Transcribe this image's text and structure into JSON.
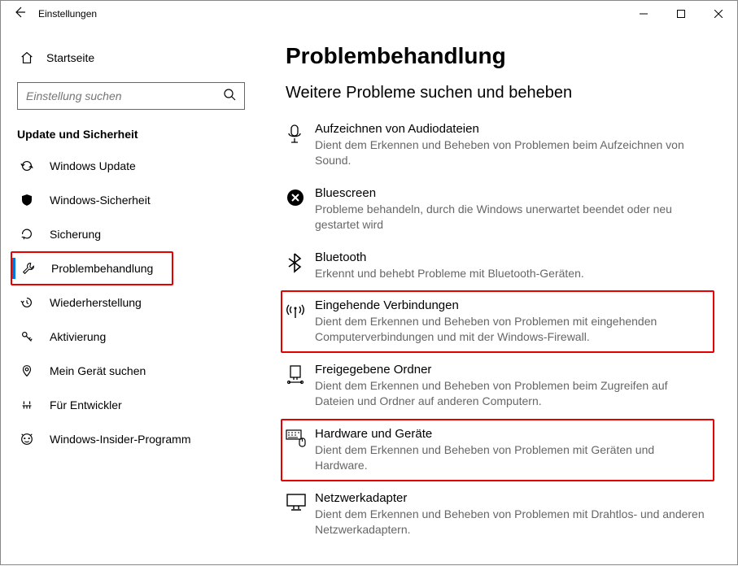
{
  "window": {
    "title": "Einstellungen"
  },
  "sidebar": {
    "home": "Startseite",
    "search_placeholder": "Einstellung suchen",
    "group": "Update und Sicherheit",
    "items": [
      {
        "label": "Windows Update"
      },
      {
        "label": "Windows-Sicherheit"
      },
      {
        "label": "Sicherung"
      },
      {
        "label": "Problembehandlung"
      },
      {
        "label": "Wiederherstellung"
      },
      {
        "label": "Aktivierung"
      },
      {
        "label": "Mein Gerät suchen"
      },
      {
        "label": "Für Entwickler"
      },
      {
        "label": "Windows-Insider-Programm"
      }
    ]
  },
  "main": {
    "heading": "Problembehandlung",
    "subheading": "Weitere Probleme suchen und beheben",
    "items": [
      {
        "label": "Aufzeichnen von Audiodateien",
        "desc": "Dient dem Erkennen und Beheben von Problemen beim Aufzeichnen von Sound."
      },
      {
        "label": "Bluescreen",
        "desc": "Probleme behandeln, durch die Windows unerwartet beendet oder neu gestartet wird"
      },
      {
        "label": "Bluetooth",
        "desc": "Erkennt und behebt Probleme mit Bluetooth-Geräten."
      },
      {
        "label": "Eingehende Verbindungen",
        "desc": "Dient dem Erkennen und Beheben von Problemen mit eingehenden Computerverbindungen und mit der Windows-Firewall."
      },
      {
        "label": "Freigegebene Ordner",
        "desc": "Dient dem Erkennen und Beheben von Problemen beim Zugreifen auf Dateien und Ordner auf anderen Computern."
      },
      {
        "label": "Hardware und Geräte",
        "desc": "Dient dem Erkennen und Beheben von Problemen mit Geräten und Hardware."
      },
      {
        "label": "Netzwerkadapter",
        "desc": "Dient dem Erkennen und Beheben von Problemen mit Drahtlos- und anderen Netzwerkadaptern."
      }
    ]
  }
}
